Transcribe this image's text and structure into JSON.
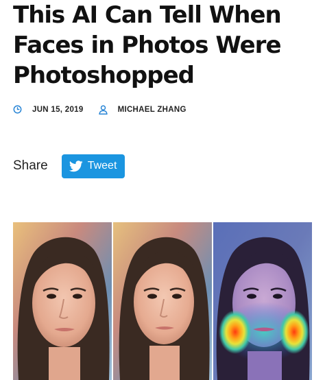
{
  "article": {
    "title_lines": [
      "This AI Can Tell When",
      "Faces in Photos Were",
      "Photoshopped"
    ],
    "date": "JUN 15, 2019",
    "author": "MICHAEL ZHANG"
  },
  "share": {
    "label": "Share",
    "tweet_label": "Tweet"
  },
  "icons": {
    "date": "clock-icon",
    "author": "person-icon",
    "tweet": "twitter-bird-icon"
  },
  "colors": {
    "accent": "#1b95e0",
    "meta_icon": "#2a86d6"
  },
  "images": [
    {
      "name": "original-face-photo"
    },
    {
      "name": "photoshopped-face-photo"
    },
    {
      "name": "heatmap-face-photo"
    }
  ]
}
